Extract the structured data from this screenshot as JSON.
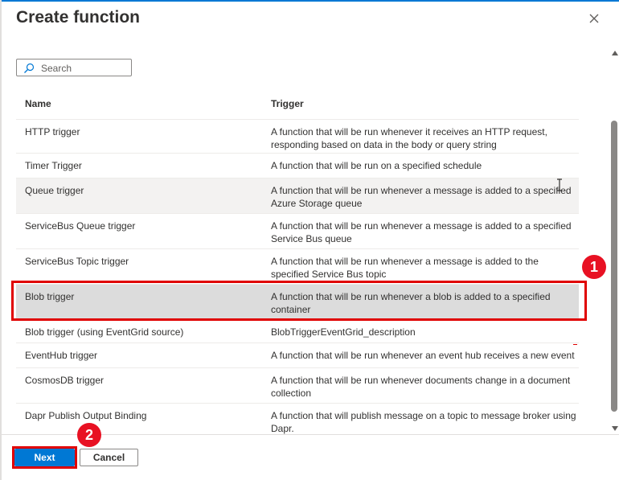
{
  "dialog": {
    "title": "Create function"
  },
  "search": {
    "placeholder": "Search",
    "value": ""
  },
  "table": {
    "headers": {
      "name": "Name",
      "trigger": "Trigger"
    },
    "rows": [
      {
        "name": "HTTP trigger",
        "description": "A function that will be run whenever it receives an HTTP request, responding based on data in the body or query string"
      },
      {
        "name": "Timer Trigger",
        "description": "A function that will be run on a specified schedule"
      },
      {
        "name": "Queue trigger",
        "description": "A function that will be run whenever a message is added to a specified Azure Storage queue"
      },
      {
        "name": "ServiceBus Queue trigger",
        "description": "A function that will be run whenever a message is added to a specified Service Bus queue"
      },
      {
        "name": "ServiceBus Topic trigger",
        "description": "A function that will be run whenever a message is added to the specified Service Bus topic"
      },
      {
        "name": "Blob trigger",
        "description": "A function that will be run whenever a blob is added to a specified container"
      },
      {
        "name": "Blob trigger (using EventGrid source)",
        "description": "BlobTriggerEventGrid_description"
      },
      {
        "name": "EventHub trigger",
        "description": "A function that will be run whenever an event hub receives a new event"
      },
      {
        "name": "CosmosDB trigger",
        "description": "A function that will be run whenever documents change in a document collection"
      },
      {
        "name": "Dapr Publish Output Binding",
        "description": "A function that will publish message on a topic to message broker using Dapr."
      }
    ],
    "selected_row": "Blob trigger",
    "hovered_row": "Queue trigger"
  },
  "annotations": {
    "step1": "1",
    "step2": "2",
    "color": "#e00000"
  },
  "footer": {
    "next_label": "Next",
    "cancel_label": "Cancel"
  },
  "icons": {
    "close": "close-icon",
    "search": "search-icon"
  },
  "colors": {
    "primary": "#0078d4",
    "selected_row": "#dcdcdc",
    "hover_row": "#f3f2f1"
  }
}
